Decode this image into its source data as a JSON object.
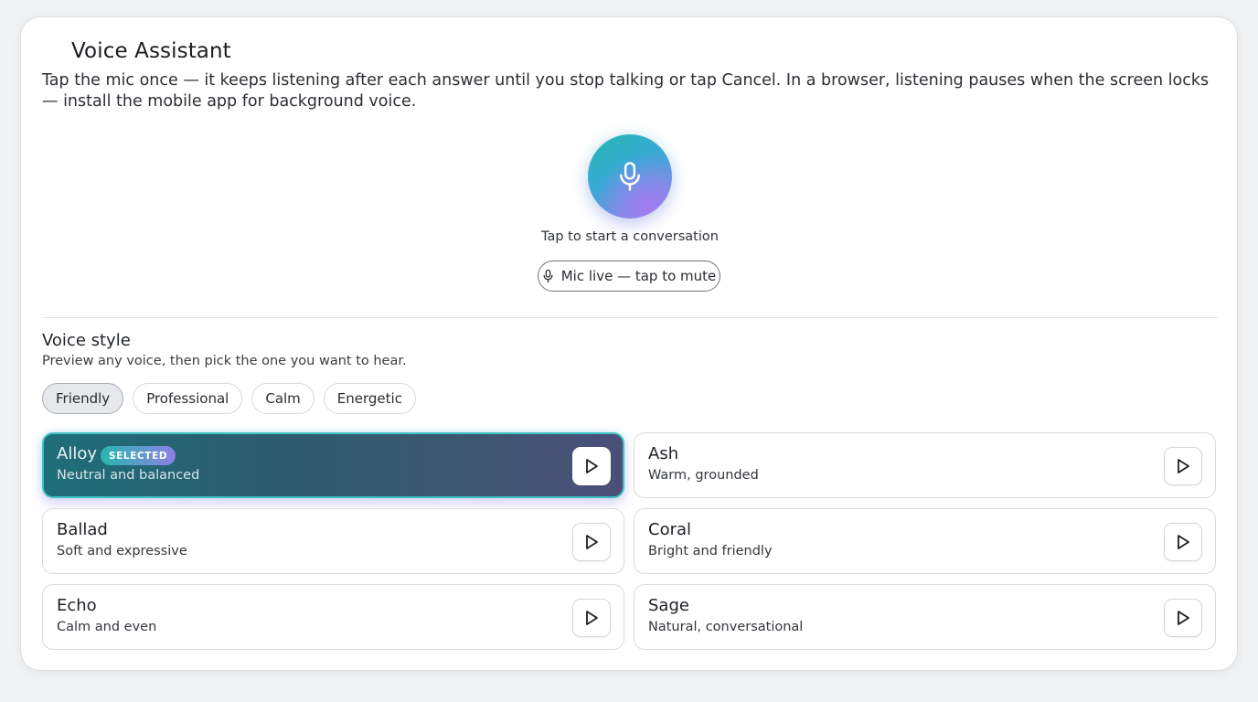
{
  "header": {
    "title": "Voice Assistant",
    "description": "Tap the mic once — it keeps listening after each answer until you stop talking or tap Cancel. In a browser, listening pauses when the screen locks — install the mobile app for background voice."
  },
  "mic": {
    "icon": "microphone-icon",
    "hint": "Tap to start a conversation",
    "mute_label": "Mic live — tap to mute",
    "gradient_colors": [
      "#22b9b2",
      "#3ba9d6",
      "#8f86ea"
    ]
  },
  "voice_style": {
    "title": "Voice style",
    "subtitle": "Preview any voice, then pick the one you want to hear.",
    "styles": [
      {
        "label": "Friendly",
        "active": true
      },
      {
        "label": "Professional",
        "active": false
      },
      {
        "label": "Calm",
        "active": false
      },
      {
        "label": "Energetic",
        "active": false
      }
    ],
    "selected_badge": "SELECTED",
    "voices": [
      {
        "name": "Alloy",
        "description": "Neutral and balanced",
        "selected": true
      },
      {
        "name": "Ash",
        "description": "Warm, grounded",
        "selected": false
      },
      {
        "name": "Ballad",
        "description": "Soft and expressive",
        "selected": false
      },
      {
        "name": "Coral",
        "description": "Bright and friendly",
        "selected": false
      },
      {
        "name": "Echo",
        "description": "Calm and even",
        "selected": false
      },
      {
        "name": "Sage",
        "description": "Natural, conversational",
        "selected": false
      }
    ],
    "play_icon": "play-icon"
  }
}
